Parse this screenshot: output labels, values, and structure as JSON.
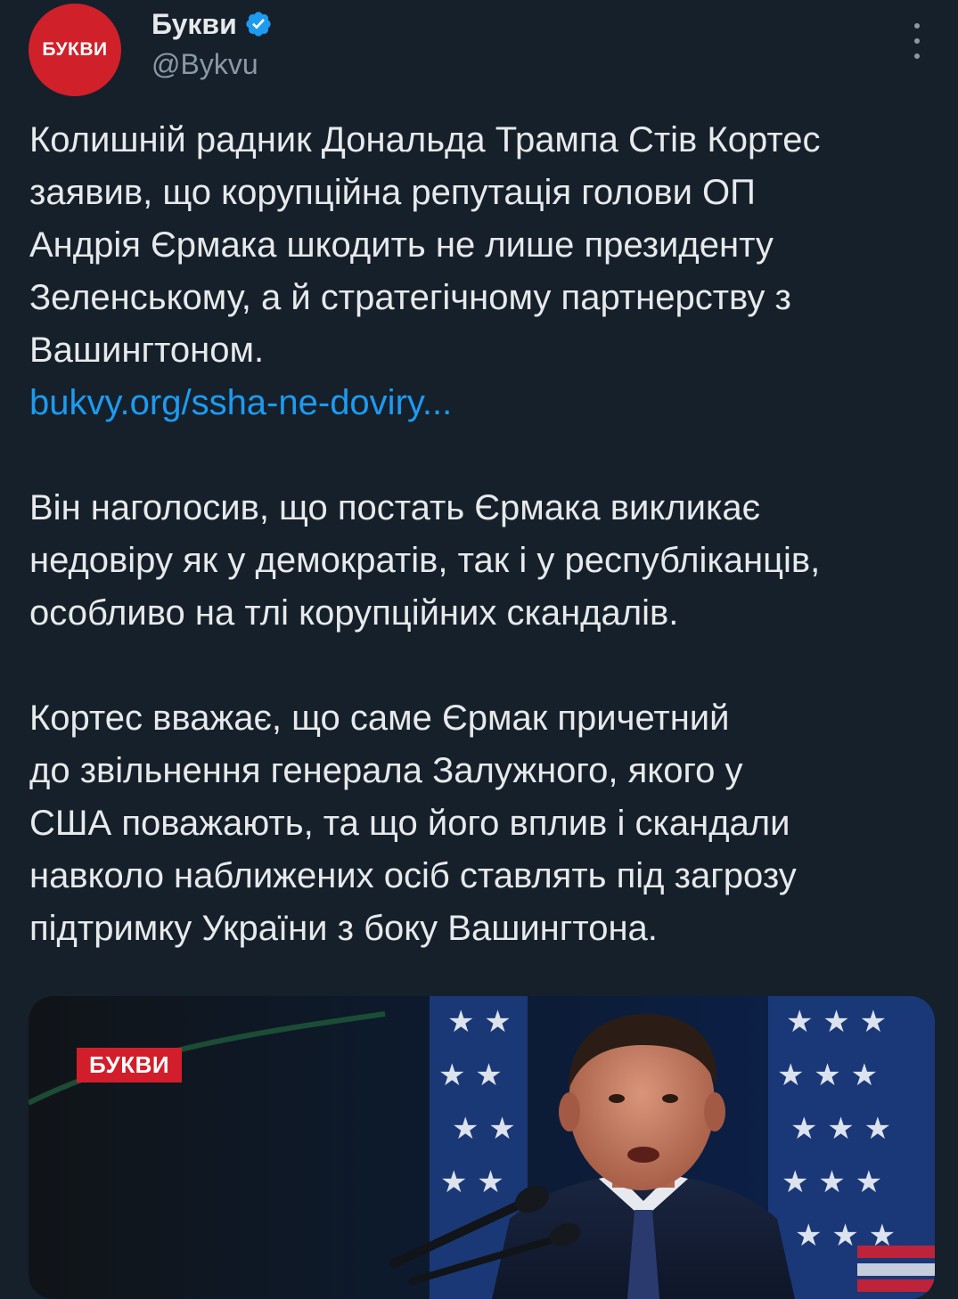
{
  "author": {
    "avatar_text": "БУКВИ",
    "name": "Букви",
    "handle": "@Bykvu",
    "verified": true
  },
  "tweet": {
    "paragraph1": [
      "Колишній радник Дональда Трампа Стів Кортес",
      "заявив, що  корупційна репутація голови ОП",
      "Андрія Єрмака шкодить не лише президенту",
      "Зеленському, а й стратегічному партнерству з",
      "Вашингтоном."
    ],
    "link": "bukvy.org/ssha-ne-doviry...",
    "paragraph2": [
      "Він наголосив, що постать Єрмака викликає",
      "недовіру як у демократів, так і у республіканців,",
      "особливо на тлі корупційних скандалів."
    ],
    "paragraph3": [
      "Кортес вважає, що саме Єрмак причетний",
      "до звільнення генерала Залужного, якого у",
      "США поважають, та що його вплив і скандали",
      "навколо наближених осіб ставлять під загрозу",
      "підтримку України з боку Вашингтона."
    ]
  },
  "media": {
    "badge": "БУКВИ"
  },
  "colors": {
    "background": "#15202b",
    "text": "#e7e9ea",
    "secondary": "#8b98a5",
    "link": "#1d9bf0",
    "brand_red": "#d0202a"
  },
  "icons": {
    "verified": "verified-badge-icon",
    "more": "more-options-icon"
  }
}
